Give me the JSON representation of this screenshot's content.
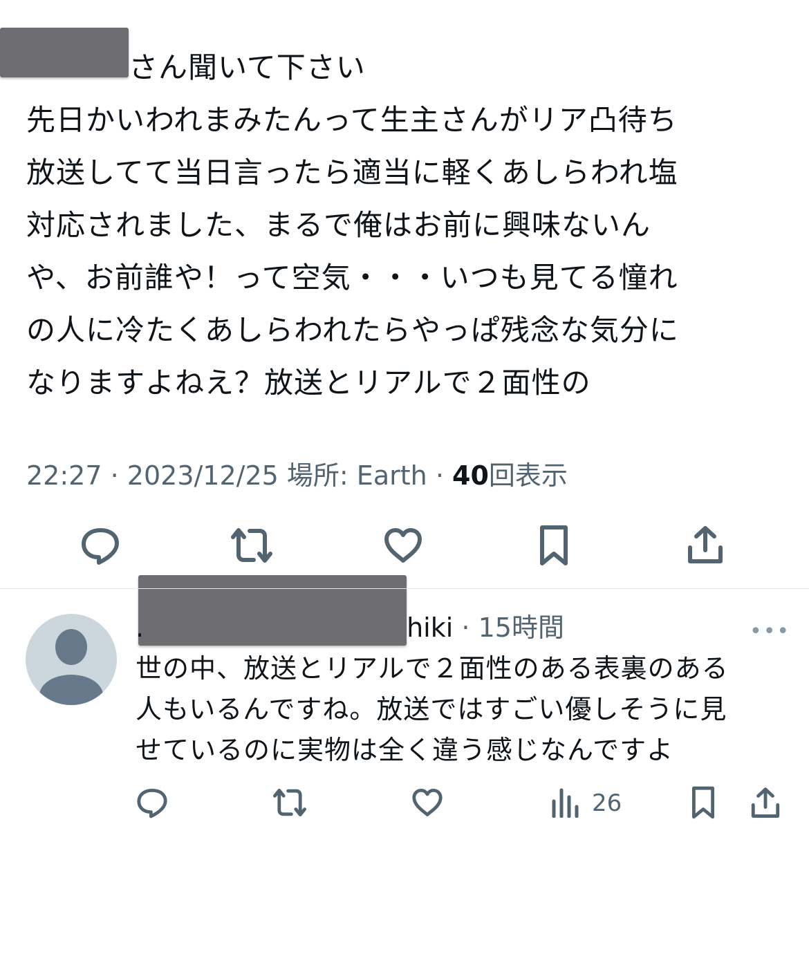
{
  "tweet": {
    "text_lines": [
      "さん聞いて下さい",
      "先日かいわれまみたんって生主さんがリア凸待ち",
      "放送してて当日言ったら適当に軽くあしらわれ塩",
      "対応されました、まるで俺はお前に興味ないん",
      "や、お前誰や！って空気・・・いつも見てる憧れ",
      "の人に冷たくあしらわれたらやっぱ残念な気分に",
      "なりますよねえ？放送とリアルで２面性の"
    ],
    "time": "22:27",
    "date": "2023/12/25",
    "location_label": "場所: Earth",
    "separator": "·",
    "views_count": "40",
    "views_label": "回表示"
  },
  "actions": {
    "reply_icon": "reply-icon",
    "retweet_icon": "retweet-icon",
    "like_icon": "like-icon",
    "bookmark_icon": "bookmark-icon",
    "share_icon": "share-icon"
  },
  "reply": {
    "name_prefix": ".",
    "name_suffix": "hiki",
    "separator": "·",
    "time_ago": "15時間",
    "more_label": "•••",
    "text_lines": [
      "世の中、放送とリアルで２面性のある表裏のある",
      "人もいるんですね。放送ではすごい優しそうに見",
      "せているのに実物は全く違う感じなんですよ"
    ],
    "views": "26"
  },
  "colors": {
    "text": "#0f1419",
    "secondary": "#536471",
    "redaction": "#6e6e72",
    "avatar_bg": "#ccd6dd",
    "avatar_fg": "#66788a"
  }
}
